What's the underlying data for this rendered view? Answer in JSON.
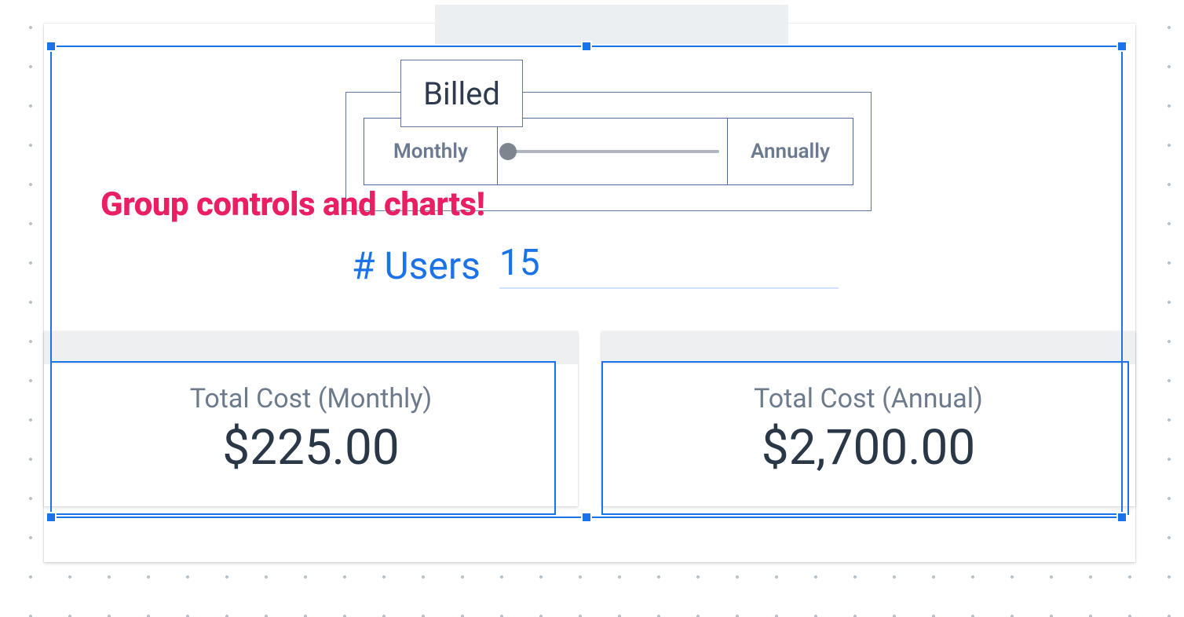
{
  "billing": {
    "label": "Billed",
    "options": {
      "left": "Monthly",
      "right": "Annually"
    },
    "slider_position": "left"
  },
  "users": {
    "label": "# Users",
    "value": "15"
  },
  "callout": "Group controls and charts!",
  "stats": {
    "monthly": {
      "title": "Total Cost (Monthly)",
      "value": "$225.00"
    },
    "annual": {
      "title": "Total Cost (Annual)",
      "value": "$2,700.00"
    }
  },
  "chart_data": [
    {
      "type": "table",
      "title": "Total Cost (Monthly)",
      "categories": [
        "Total Cost (Monthly)"
      ],
      "values": [
        225.0
      ]
    },
    {
      "type": "table",
      "title": "Total Cost (Annual)",
      "categories": [
        "Total Cost (Annual)"
      ],
      "values": [
        2700.0
      ]
    }
  ]
}
